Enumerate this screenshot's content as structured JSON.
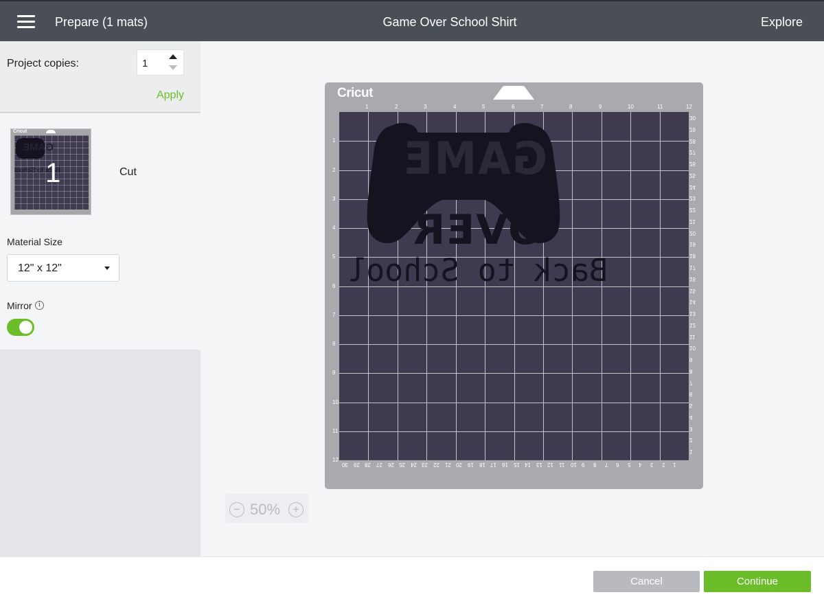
{
  "header": {
    "prepare_title": "Prepare (1 mats)",
    "project_title": "Game Over School Shirt",
    "explore_label": "Explore"
  },
  "sidebar": {
    "copies_label": "Project copies:",
    "copies_value": "1",
    "apply_label": "Apply",
    "mat": {
      "number": "1",
      "label": "Cut",
      "brand": "Cricut"
    },
    "material_size_label": "Material Size",
    "material_size_value": "12\" x 12\"",
    "mirror_label": "Mirror",
    "mirror_on": true
  },
  "canvas": {
    "mat_brand": "Cricut",
    "ruler_top": [
      "1",
      "2",
      "3",
      "4",
      "5",
      "6",
      "7",
      "8",
      "9",
      "10",
      "11",
      "12"
    ],
    "ruler_left": [
      "1",
      "2",
      "3",
      "4",
      "5",
      "6",
      "7",
      "8",
      "9",
      "10",
      "11",
      "12"
    ],
    "ruler_right": [
      "30",
      "29",
      "28",
      "27",
      "26",
      "25",
      "24",
      "23",
      "22",
      "21",
      "20",
      "19",
      "18",
      "17",
      "16",
      "15",
      "14",
      "13",
      "12",
      "11",
      "10",
      "9",
      "8",
      "7",
      "6",
      "5",
      "4",
      "3",
      "2",
      "1"
    ],
    "ruler_bottom": [
      "30",
      "29",
      "28",
      "27",
      "26",
      "25",
      "24",
      "23",
      "22",
      "21",
      "20",
      "19",
      "18",
      "17",
      "16",
      "15",
      "14",
      "13",
      "12",
      "11",
      "10",
      "9",
      "8",
      "7",
      "6",
      "5",
      "4",
      "3",
      "2",
      "1"
    ],
    "design_text": {
      "line1": "GAME",
      "line2": "OVER",
      "line3": "Back to School"
    },
    "zoom_value": "50%",
    "zoom_out": "−",
    "zoom_in": "+"
  },
  "footer": {
    "cancel_label": "Cancel",
    "continue_label": "Continue"
  },
  "colors": {
    "accent": "#6bbd29",
    "header_bg": "#4a4f57",
    "mat_grid": "#3f3a50",
    "mat_frame": "#a8aaad"
  }
}
